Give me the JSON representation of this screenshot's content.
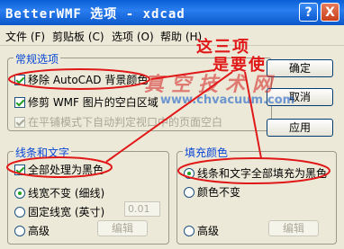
{
  "window": {
    "title": "BetterWMF 选项 - xdcad",
    "help_label": "?",
    "close_label": "X"
  },
  "menu": {
    "items": [
      "文件 (F)",
      "剪贴板 (C)",
      "选项 (O)",
      "帮助 (H)"
    ]
  },
  "general": {
    "legend": "常规选项",
    "options": [
      {
        "label": "移除 AutoCAD 背景颜色",
        "checked": true,
        "enabled": true
      },
      {
        "label": "修剪 WMF 图片的空白区域",
        "checked": true,
        "enabled": true
      },
      {
        "label": "在平铺模式下自动判定视口中的页面空白",
        "checked": true,
        "enabled": false
      }
    ]
  },
  "lines_text": {
    "legend": "线条和文字",
    "all_black_label": "全部处理为黑色",
    "all_black_checked": true,
    "radio_keep_width": "线宽不变 (细线)",
    "radio_fixed_width": "固定线宽 (英寸)",
    "fixed_width_value": "0.01",
    "radio_advanced": "高级",
    "edit_label": "编辑"
  },
  "fill": {
    "legend": "填充颜色",
    "radio_all_black": "线条和文字全部填充为黑色",
    "radio_keep_color": "颜色不变",
    "radio_advanced": "高级",
    "edit_label": "编辑"
  },
  "buttons": {
    "ok": "确定",
    "cancel": "取消",
    "apply": "应用"
  },
  "annotation": {
    "line1": "这三项",
    "line2": "是要使"
  },
  "watermark": {
    "line1": "真空技术网",
    "line2": "www.chvacuum.com"
  },
  "colors": {
    "annotation": "#e01818",
    "titlebar": "#0a5fd6",
    "accent_legend": "#0a46d6"
  }
}
